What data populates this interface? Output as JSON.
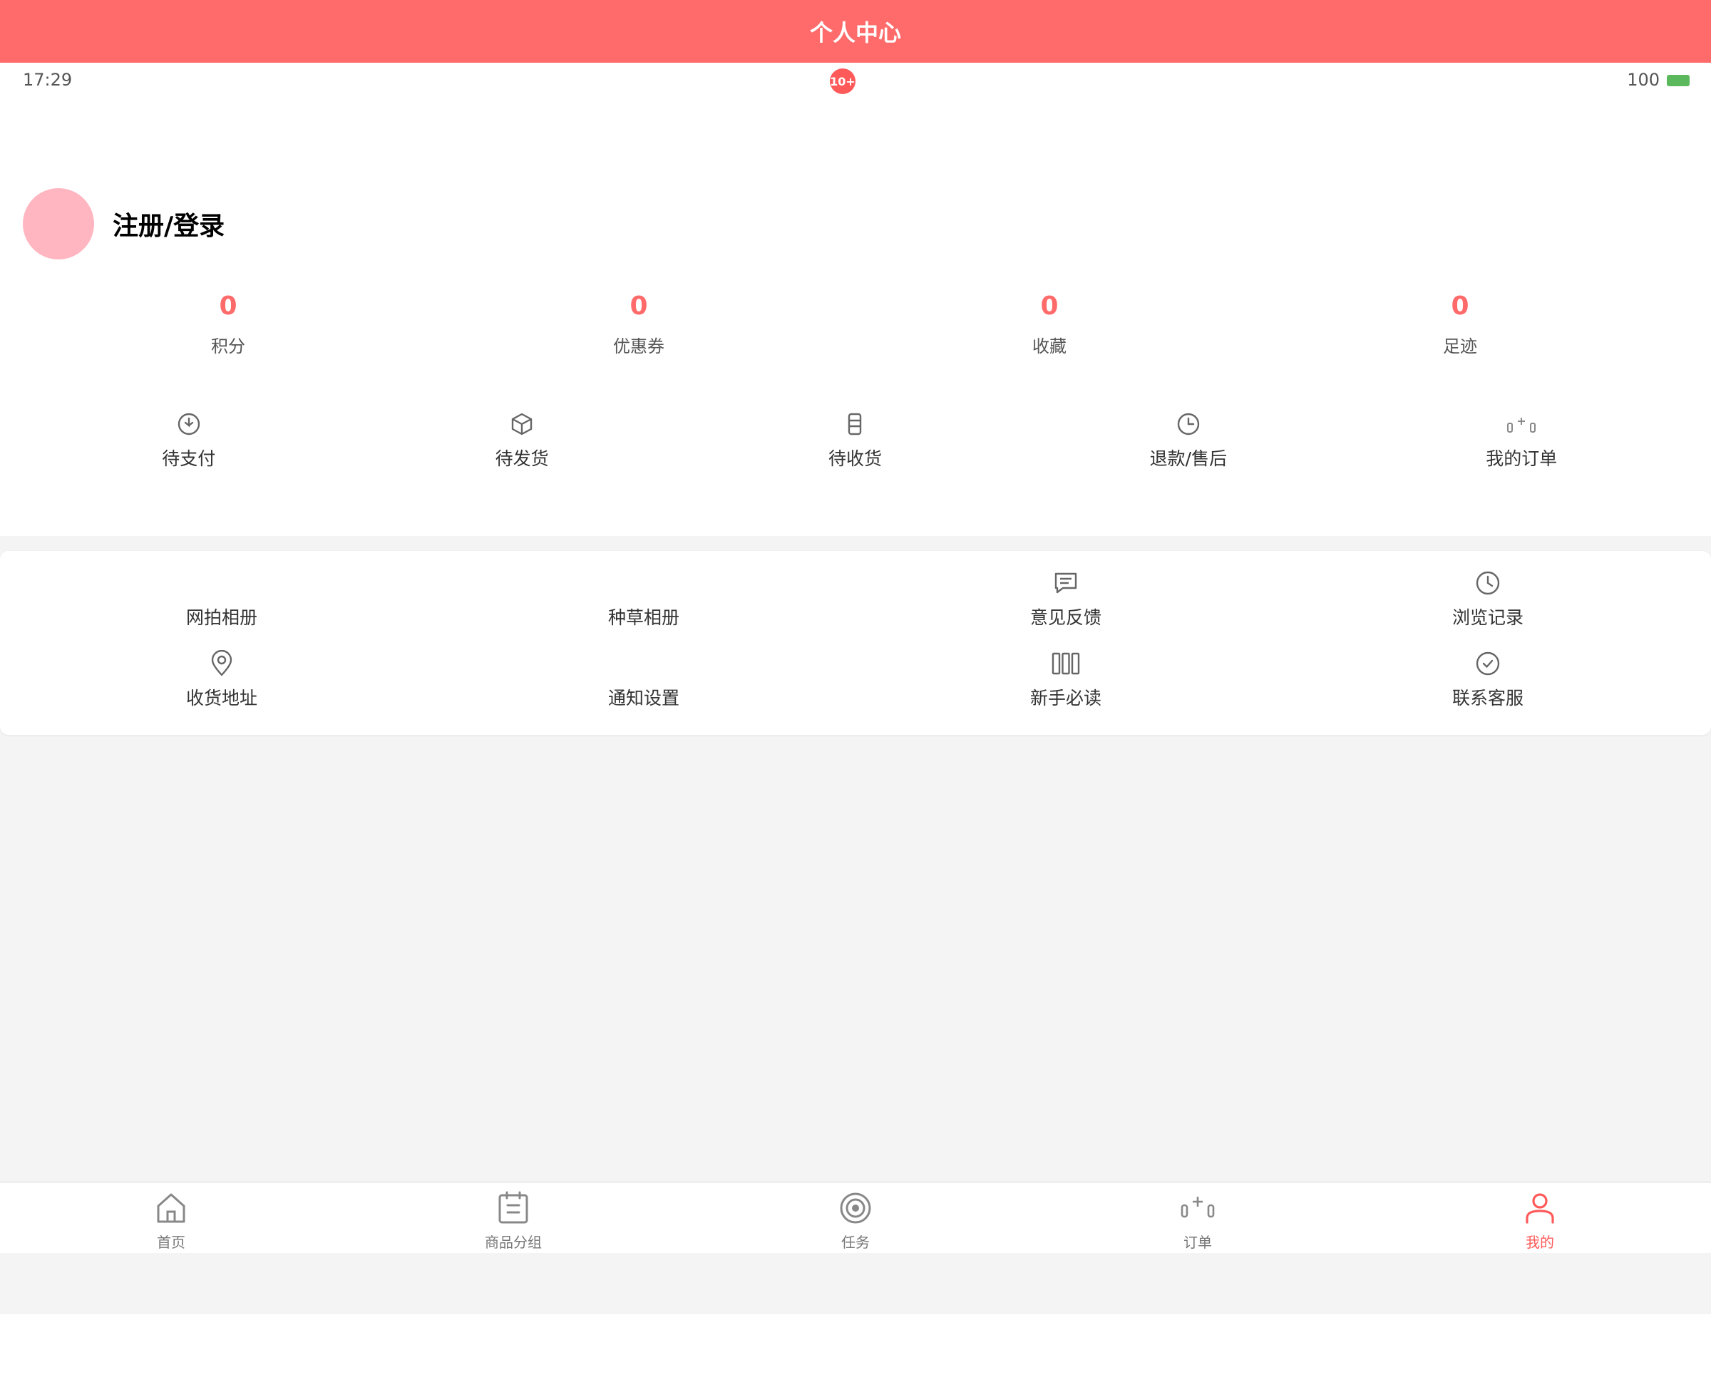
{
  "app": {
    "title": "个人中心"
  },
  "status_bar": {
    "time": "17:29",
    "badge": "10+",
    "battery": "100"
  },
  "profile": {
    "login_label": "注册/登录"
  },
  "stats": [
    {
      "value": "0",
      "label": "积分"
    },
    {
      "value": "0",
      "label": "优惠券"
    },
    {
      "value": "0",
      "label": "收藏"
    },
    {
      "value": "0",
      "label": "足迹"
    }
  ],
  "orders": [
    {
      "label": "待支付",
      "icon": "pending-payment-icon"
    },
    {
      "label": "待发货",
      "icon": "box-icon"
    },
    {
      "label": "待收货",
      "icon": "phone-icon"
    },
    {
      "label": "退款/售后",
      "icon": "clock-icon"
    },
    {
      "label": "我的订单",
      "icon": "order-list-icon"
    }
  ],
  "tools": [
    {
      "label": "网拍相册",
      "icon": ""
    },
    {
      "label": "种草相册",
      "icon": ""
    },
    {
      "label": "意见反馈",
      "icon": "message-icon"
    },
    {
      "label": "浏览记录",
      "icon": "clock-icon"
    },
    {
      "label": "收货地址",
      "icon": "location-icon"
    },
    {
      "label": "通知设置",
      "icon": ""
    },
    {
      "label": "新手必读",
      "icon": "columns-icon"
    },
    {
      "label": "联系客服",
      "icon": "check-circle-icon"
    }
  ],
  "tabbar": [
    {
      "label": "首页",
      "icon": "home-icon",
      "active": false
    },
    {
      "label": "商品分组",
      "icon": "calendar-icon",
      "active": false
    },
    {
      "label": "任务",
      "icon": "target-icon",
      "active": false
    },
    {
      "label": "订单",
      "icon": "order-list-icon",
      "active": false
    },
    {
      "label": "我的",
      "icon": "user-icon",
      "active": true
    }
  ],
  "colors": {
    "brand": "#ff6b6b",
    "badge": "#ff5a5a",
    "battery": "#5cb85c",
    "avatar": "#ffb6c1"
  }
}
